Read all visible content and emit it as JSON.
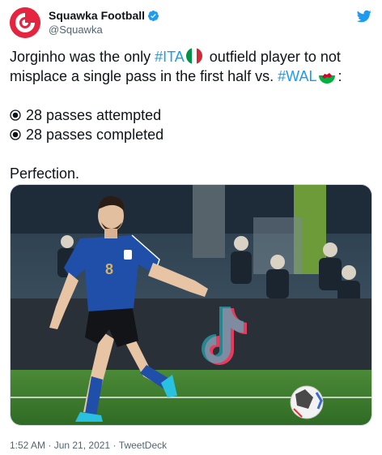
{
  "author": {
    "display_name": "Squawka Football",
    "handle": "@Squawka",
    "verified": true,
    "avatar_icon": "squawka-logo-icon",
    "brand_color": "#e5253f"
  },
  "tweet": {
    "line1_prefix": "Jorginho was the only ",
    "hashtag_ita": "#ITA",
    "line1_suffix": " outfield player to not",
    "line2_prefix": "misplace a single pass in the first half vs. ",
    "hashtag_wal": "#WAL",
    "line2_suffix": ":",
    "stats": [
      {
        "bullet_icon": "radio-button-icon",
        "text": "28 passes attempted"
      },
      {
        "bullet_icon": "radio-button-icon",
        "text": "28 passes completed"
      }
    ],
    "closing": "Perfection."
  },
  "photo": {
    "shirt_number": "8"
  },
  "meta": {
    "time": "1:52 AM",
    "separator": " · ",
    "date": "Jun 21, 2021",
    "source": "TweetDeck"
  },
  "colors": {
    "link": "#1d9bf0",
    "muted": "#536471",
    "text": "#0f1419",
    "italy_blue": "#1f4fa8",
    "pitch_green": "#3d7a2e"
  }
}
